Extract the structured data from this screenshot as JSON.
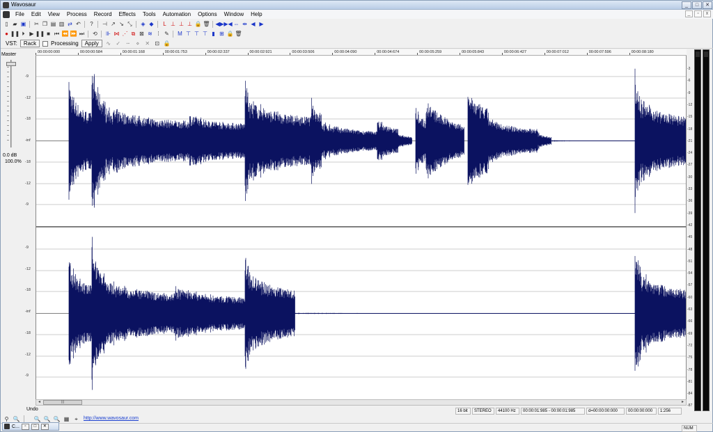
{
  "window": {
    "title": "Wavosaur"
  },
  "menu": [
    "File",
    "Edit",
    "View",
    "Process",
    "Record",
    "Effects",
    "Tools",
    "Automation",
    "Options",
    "Window",
    "Help"
  ],
  "vst": {
    "label": "VST:",
    "rack_label": "Rack",
    "processing_label": "Processing",
    "apply_label": "Apply"
  },
  "master": {
    "label": "Master",
    "gain": "0.0 dB",
    "percent": "100.0%"
  },
  "timeline": [
    "00:00:00:000",
    "00:00:00:584",
    "00:00:01:168",
    "00:00:01:753",
    "00:00:02:337",
    "00:00:02:921",
    "00:00:03:506",
    "00:00:04:090",
    "00:00:04:674",
    "00:00:05:259",
    "00:00:05:843",
    "00:00:06:427",
    "00:00:07:012",
    "00:00:07:596",
    "00:00:08:180"
  ],
  "left_scale": [
    "-9",
    "-12",
    "-18",
    "-inf",
    "-18",
    "-12",
    "-9"
  ],
  "right_scale": [
    "-3",
    "-6",
    "-9",
    "-12",
    "-15",
    "-18",
    "-21",
    "-24",
    "-27",
    "-30",
    "-33",
    "-36",
    "-39",
    "-42",
    "-45",
    "-48",
    "-51",
    "-54",
    "-57",
    "-60",
    "-63",
    "-66",
    "-69",
    "-72",
    "-75",
    "-78",
    "-81",
    "-84",
    "-87"
  ],
  "undo_label": "Undo",
  "url": "http://www.wavosaur.com",
  "status": {
    "bits": "16 bit",
    "channels": "STEREO",
    "rate": "44100 Hz",
    "selection": "00:00:01:985 - 00:00:01:985",
    "duration": "d=00:00:00:000",
    "cursor": "00:00:00:000",
    "zoom": "1:256",
    "num": "NUM"
  },
  "minimized_window": {
    "label": "C..."
  },
  "colors": {
    "waveform": "#0b1260",
    "grid": "#9a9a9a",
    "meter": "#0a0a0a"
  }
}
